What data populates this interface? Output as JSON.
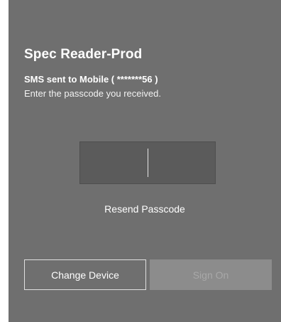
{
  "app": {
    "title": "Spec Reader-Prod"
  },
  "message": {
    "sms_sent": "SMS sent to Mobile ( *******56 )",
    "instruction": "Enter the passcode you received."
  },
  "passcode": {
    "value": ""
  },
  "actions": {
    "resend_label": "Resend Passcode",
    "change_device_label": "Change Device",
    "sign_on_label": "Sign On"
  },
  "colors": {
    "card_background": "#6f6f6f",
    "input_background": "#5b5b5b",
    "disabled_button": "#8c8c8c"
  }
}
